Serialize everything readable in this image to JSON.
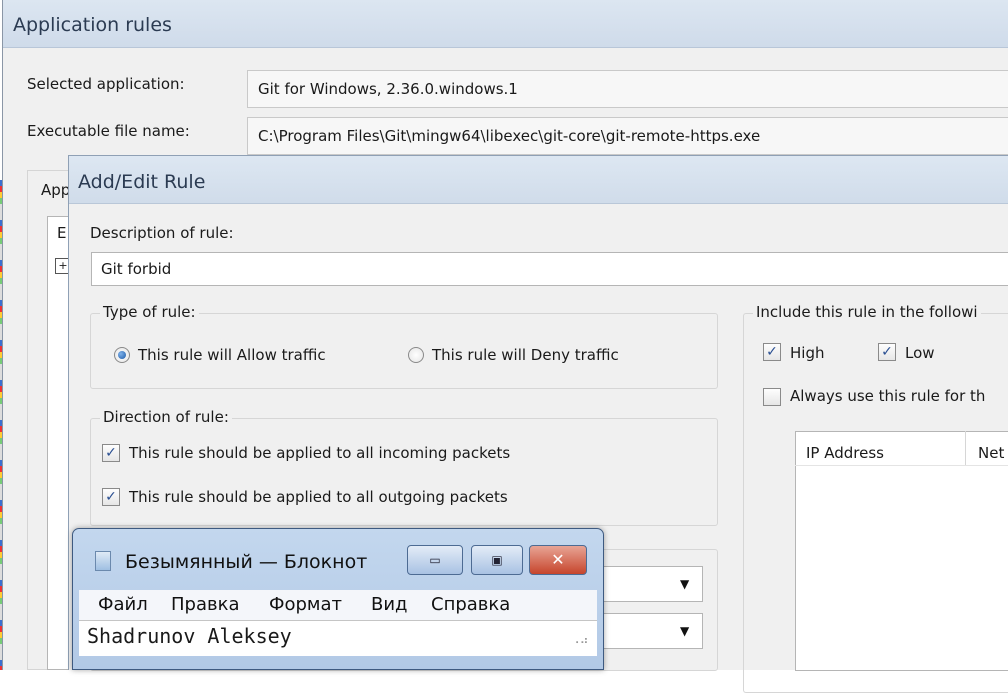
{
  "app_window": {
    "title": "Application rules",
    "selected_application_label": "Selected application:",
    "selected_application_value": "Git for Windows, 2.36.0.windows.1",
    "executable_label": "Executable file name:",
    "executable_value": "C:\\Program Files\\Git\\mingw64\\libexec\\git-core\\git-remote-https.exe",
    "applications_group_label": "App",
    "list_column_first_letter": "E"
  },
  "rule_dialog": {
    "title": "Add/Edit Rule",
    "description_label": "Description of rule:",
    "description_value": "Git forbid",
    "type_group_label": "Type of rule:",
    "allow_label": "This rule will Allow traffic",
    "allow_selected": true,
    "deny_label": "This rule will Deny traffic",
    "deny_selected": false,
    "direction_group_label": "Direction of rule:",
    "incoming_label": "This rule should be applied to all incoming packets",
    "incoming_checked": true,
    "outgoing_label": "This rule should be applied to all outgoing packets",
    "outgoing_checked": true,
    "include_label": "Include this rule in the followi",
    "high_label": "High",
    "high_checked": true,
    "low_label": "Low",
    "low_checked": true,
    "always_label": "Always use this rule for th",
    "always_checked": false,
    "ip_columns": [
      "IP Address",
      "Net"
    ]
  },
  "notepad": {
    "title": "Безымянный — Блокнот",
    "menu": [
      "Файл",
      "Правка",
      "Формат",
      "Вид",
      "Справка"
    ],
    "text": "Shadrunov Aleksey",
    "minimize_symbol": "▭",
    "maximize_symbol": "▣",
    "close_symbol": "✕"
  },
  "colors": {
    "accent_blue": "#1d5aa8",
    "close_red": "#c6452c",
    "window_bg": "#f0f0f0"
  }
}
